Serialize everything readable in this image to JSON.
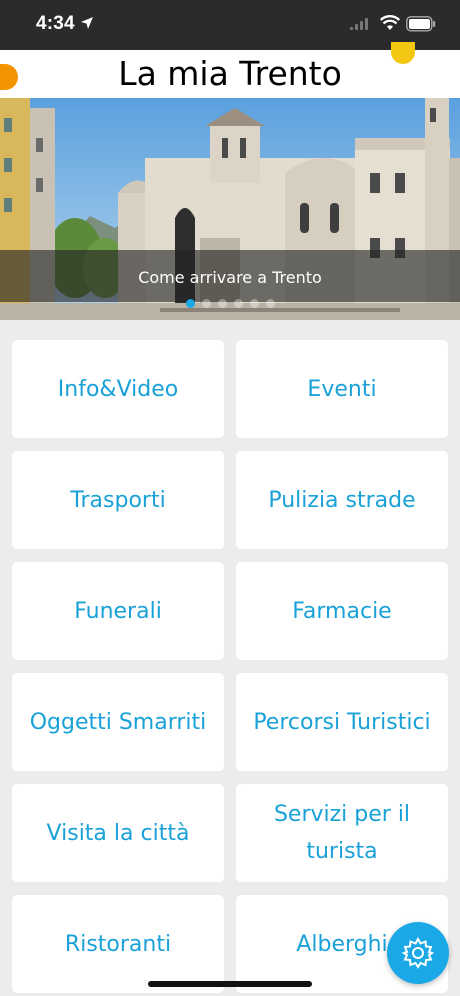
{
  "status_bar": {
    "time": "4:34"
  },
  "header": {
    "title": "La mia Trento"
  },
  "banner": {
    "caption": "Come arrivare a Trento",
    "slide_count": 6,
    "active_slide": 0
  },
  "tiles": [
    {
      "label": "Info&Video"
    },
    {
      "label": "Eventi"
    },
    {
      "label": "Trasporti"
    },
    {
      "label": "Pulizia strade"
    },
    {
      "label": "Funerali"
    },
    {
      "label": "Farmacie"
    },
    {
      "label": "Oggetti Smarriti"
    },
    {
      "label": "Percorsi Turistici"
    },
    {
      "label": "Visita la città"
    },
    {
      "label_line1": "Servizi per il",
      "label_line2": "turista"
    },
    {
      "label": "Ristoranti"
    },
    {
      "label": "Alberghi"
    }
  ],
  "colors": {
    "accent_blue": "#1aa9e6",
    "tile_text": "#1aa1d8",
    "orange_accent": "#f29400",
    "yellow_accent": "#f4c713"
  },
  "icons": {
    "fab": "settings-gear-icon"
  }
}
